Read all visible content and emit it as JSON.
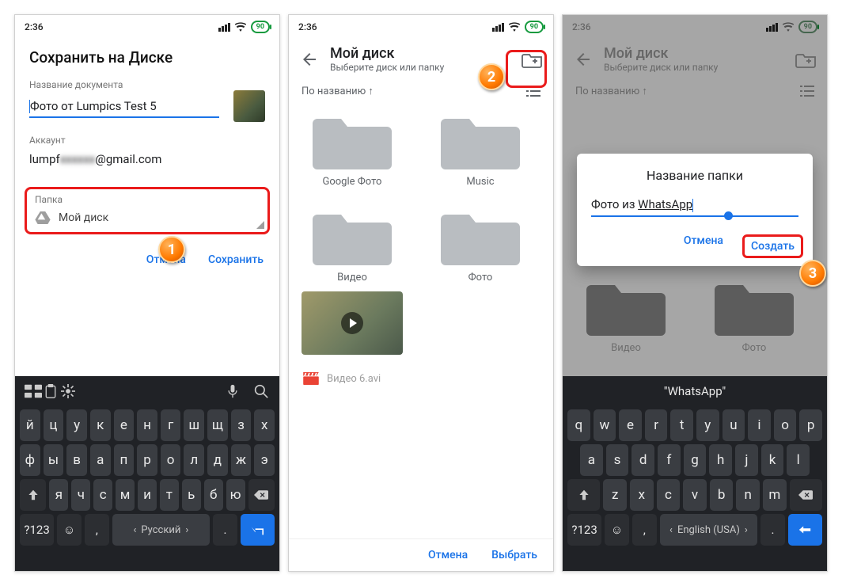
{
  "status": {
    "time": "2:36",
    "battery_label": "90"
  },
  "badges": {
    "one": "1",
    "two": "2",
    "three": "3"
  },
  "s1": {
    "title": "Сохранить на Диске",
    "doc_label": "Название документа",
    "doc_value": "Фото от Lumpics Test 5",
    "account_label": "Аккаунт",
    "account_prefix": "lumpf",
    "account_masked": "xxxxxx",
    "account_suffix": "@gmail.com",
    "folder_label": "Папка",
    "folder_value": "Мой диск",
    "cancel": "Отмена",
    "save": "Сохранить"
  },
  "s2": {
    "heading": "Мой диск",
    "sub": "Выберите диск или папку",
    "sort": "По названию",
    "folders": [
      "Google Фото",
      "Music",
      "Видео",
      "Фото"
    ],
    "avi": "Видео 6.avi",
    "cancel": "Отмена",
    "choose": "Выбрать"
  },
  "s3": {
    "heading": "Мой диск",
    "sub": "Выберите диск или папку",
    "sort": "По названию",
    "folders": [
      "Видео",
      "Фото"
    ],
    "dialog_title": "Название папки",
    "dialog_prefix": "Фото из ",
    "dialog_under": "WhatsApp",
    "cancel": "Отмена",
    "create": "Создать"
  },
  "kb_ru": {
    "r1": [
      "й",
      "ц",
      "у",
      "к",
      "е",
      "н",
      "г",
      "ш",
      "щ",
      "з",
      "х"
    ],
    "r2": [
      "ф",
      "ы",
      "в",
      "а",
      "п",
      "р",
      "о",
      "л",
      "д",
      "ж",
      "э"
    ],
    "r3_mid": [
      "я",
      "ч",
      "с",
      "м",
      "и",
      "т",
      "ь",
      "б",
      "ю"
    ],
    "space_label": "Русский",
    "num_label": "?123"
  },
  "kb_en": {
    "suggestion": "\"WhatsApp\"",
    "r1": [
      "q",
      "w",
      "e",
      "r",
      "t",
      "y",
      "u",
      "i",
      "o",
      "p"
    ],
    "r2": [
      "a",
      "s",
      "d",
      "f",
      "g",
      "h",
      "j",
      "k",
      "l"
    ],
    "r3_mid": [
      "z",
      "x",
      "c",
      "v",
      "b",
      "n",
      "m"
    ],
    "space_label": "English (USA)",
    "num_label": "?123"
  }
}
